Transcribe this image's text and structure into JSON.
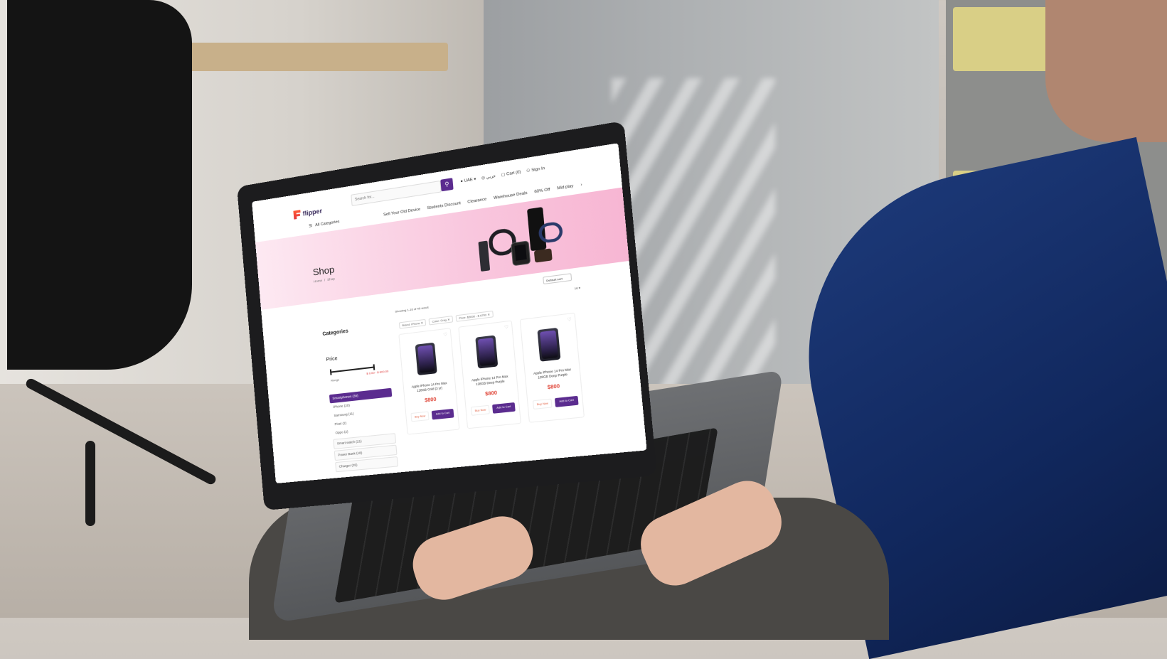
{
  "header": {
    "logo_text": "flipper",
    "search_placeholder": "Search for...",
    "country": "UAE",
    "language": "عربي",
    "cart_label": "Cart (0)",
    "signin_label": "Sign In"
  },
  "nav": {
    "all_categories": "All Categories",
    "items": [
      "Sell Your Old Device",
      "Students Discount",
      "Clearance",
      "Warehouse Deals",
      "60% Off",
      "Mid play"
    ]
  },
  "banner": {
    "title": "Shop",
    "breadcrumb": [
      "Home",
      "/",
      "Shop"
    ]
  },
  "toolbar": {
    "showing": "Showing 1-16 of 45 result",
    "sort_label": "Default sort",
    "count": "16 ▾",
    "filters": [
      "Brand: iPhone ✕",
      "Color: Gray ✕",
      "Price: $5000 - $ 6700 ✕"
    ]
  },
  "sidebar": {
    "categories_title": "Categories",
    "price_title": "Price",
    "price_label": "Range",
    "price_range": "$ 0.00 - $ 600.00",
    "categories": [
      {
        "label": "Smartphones (39)",
        "style": "active"
      },
      {
        "label": "iPhone (20)",
        "style": "plain"
      },
      {
        "label": "Samsung (11)",
        "style": "plain"
      },
      {
        "label": "Pixel (2)",
        "style": "plain"
      },
      {
        "label": "Oppo (2)",
        "style": "plain"
      },
      {
        "label": "Smart watch (21)",
        "style": "box"
      },
      {
        "label": "Power Bank (18)",
        "style": "box"
      },
      {
        "label": "Charger (35)",
        "style": "box"
      }
    ]
  },
  "products": [
    {
      "name": "Apple iPhone 14 Pro Max 128GB Gold (3 yr)",
      "price": "$800",
      "buy_label": "Buy Now",
      "cart_label": "Add to Cart"
    },
    {
      "name": "Apple iPhone 14 Pro Max 128GB Deep Purple",
      "price": "$800",
      "buy_label": "Buy Now",
      "cart_label": "Add to Cart"
    },
    {
      "name": "Apple iPhone 14 Pro Max 128GB Deep Purple",
      "price": "$800",
      "buy_label": "Buy Now",
      "cart_label": "Add to Cart"
    }
  ],
  "colors": {
    "brand_purple": "#5b2c8f",
    "price_red": "#e0483b",
    "banner_pink": "#f9c7de"
  }
}
